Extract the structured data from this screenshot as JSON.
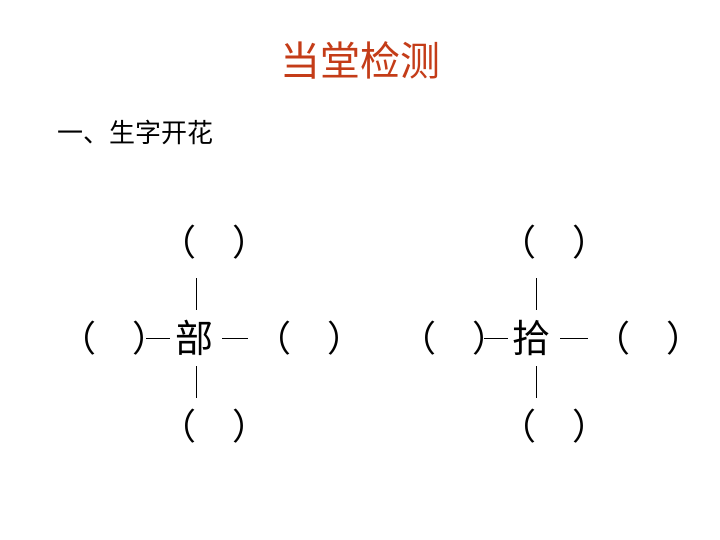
{
  "title": "当堂检测",
  "subtitle": "一、生字开花",
  "colors": {
    "title": "#c43c18",
    "text": "#000000"
  },
  "blank": "（　）",
  "flowers": [
    {
      "center": "部"
    },
    {
      "center": "拾"
    }
  ]
}
